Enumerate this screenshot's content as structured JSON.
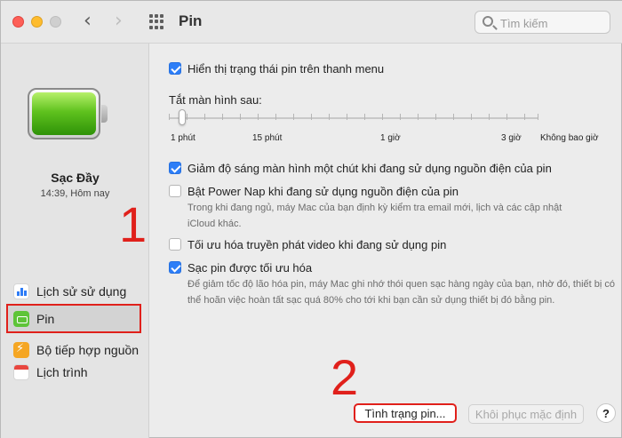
{
  "window": {
    "title": "Pin"
  },
  "search": {
    "placeholder": "Tìm kiếm"
  },
  "sidebar": {
    "charge_status": "Sạc Đầy",
    "charge_time": "14:39, Hôm nay",
    "items": [
      {
        "label": "Lịch sử sử dụng",
        "icon": "usage-chart-icon"
      },
      {
        "label": "Pin",
        "icon": "battery-icon"
      },
      {
        "label": "Bộ tiếp hợp nguồn",
        "icon": "power-adapter-icon"
      },
      {
        "label": "Lịch trình",
        "icon": "calendar-icon"
      }
    ]
  },
  "annotations": {
    "step1": "1",
    "step2": "2"
  },
  "options": {
    "show_status": {
      "label": "Hiển thị trạng thái pin trên thanh menu",
      "checked": true
    },
    "dim_display": {
      "label": "Giảm độ sáng màn hình một chút khi đang sử dụng nguồn điện của pin",
      "checked": true
    },
    "power_nap": {
      "label": "Bật Power Nap khi đang sử dụng nguồn điện của pin",
      "description": "Trong khi đang ngủ, máy Mac của bạn định kỳ kiểm tra email mới, lịch và các cập nhật iCloud khác.",
      "checked": false
    },
    "video_streaming": {
      "label": "Tối ưu hóa truyền phát video khi đang sử dụng pin",
      "checked": false
    },
    "optimized_charging": {
      "label": "Sạc pin được tối ưu hóa",
      "description": "Để giảm tốc độ lão hóa pin, máy Mac ghi nhớ thói quen sạc hàng ngày của bạn, nhờ đó, thiết bị có thể hoãn việc hoàn tất sạc quá 80% cho tới khi bạn cần sử dụng thiết bị đó bằng pin.",
      "checked": true
    }
  },
  "display_sleep": {
    "label": "Tắt màn hình sau:",
    "value": "1 phút",
    "ticks": [
      "1 phút",
      "15 phút",
      "1 giờ",
      "3 giờ",
      "Không bao giờ"
    ]
  },
  "buttons": {
    "battery_health": "Tình trạng pin...",
    "restore_defaults": "Khôi phục mặc định",
    "help": "?"
  },
  "colors": {
    "accent": "#2d7ef7",
    "annotation": "#e0201b",
    "battery_green": "#5fc21e"
  }
}
